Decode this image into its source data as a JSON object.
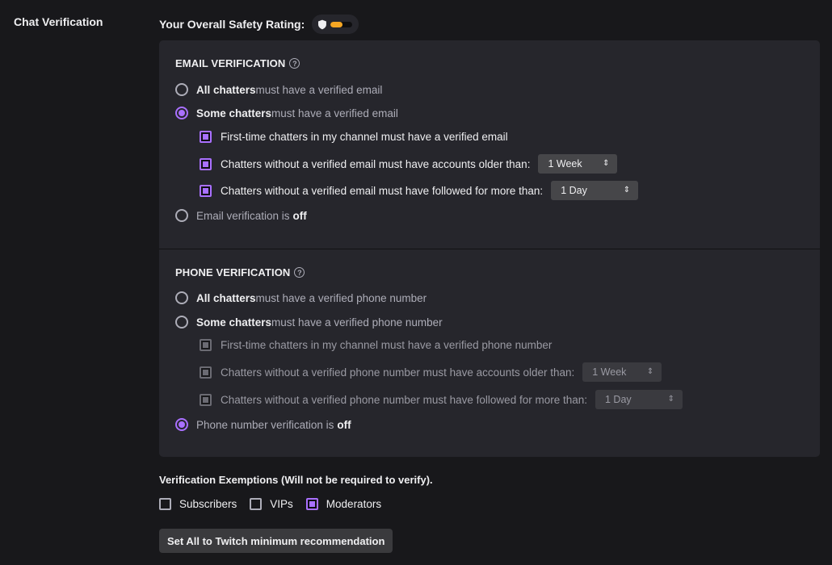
{
  "section": {
    "label": "Chat Verification"
  },
  "safety_rating": {
    "label": "Your Overall Safety Rating:",
    "icon": "shield-icon",
    "level_fraction": 0.55,
    "fill_color": "#f5a623"
  },
  "email": {
    "title": "EMAIL VERIFICATION",
    "help_icon": "?",
    "options": [
      {
        "bold": "All chatters",
        "rest": " must have a verified email",
        "selected": false
      },
      {
        "bold": "Some chatters",
        "rest": " must have a verified email",
        "selected": true
      },
      {
        "prefix": "Email verification is ",
        "bold": "off",
        "selected": false
      }
    ],
    "sub_options": [
      {
        "label": "First-time chatters in my channel must have a verified email",
        "checked": true
      },
      {
        "label": "Chatters without a verified email must have accounts older than:",
        "checked": true,
        "select_value": "1 Week"
      },
      {
        "label": "Chatters without a verified email must have followed for more than:",
        "checked": true,
        "select_value": "1 Day"
      }
    ]
  },
  "phone": {
    "title": "PHONE VERIFICATION",
    "help_icon": "?",
    "options": [
      {
        "bold": "All chatters",
        "rest": " must have a verified phone number",
        "selected": false
      },
      {
        "bold": "Some chatters",
        "rest": " must have a verified phone number",
        "selected": false
      },
      {
        "prefix": "Phone number verification is ",
        "bold": "off",
        "selected": true
      }
    ],
    "sub_options": [
      {
        "label": "First-time chatters in my channel must have a verified phone number",
        "checked": true,
        "disabled": true
      },
      {
        "label": "Chatters without a verified phone number must have accounts older than:",
        "checked": true,
        "disabled": true,
        "select_value": "1 Week"
      },
      {
        "label": "Chatters without a verified phone number must have followed for more than:",
        "checked": true,
        "disabled": true,
        "select_value": "1 Day"
      }
    ]
  },
  "exemptions": {
    "title": "Verification Exemptions (Will not be required to verify).",
    "items": [
      {
        "label": "Subscribers",
        "checked": false
      },
      {
        "label": "VIPs",
        "checked": false
      },
      {
        "label": "Moderators",
        "checked": true
      }
    ]
  },
  "actions": {
    "min_recommendation_label": "Set All to Twitch minimum recommendation"
  },
  "colors": {
    "accent": "#a970ff",
    "panel": "#26262c",
    "background": "#18181b"
  }
}
